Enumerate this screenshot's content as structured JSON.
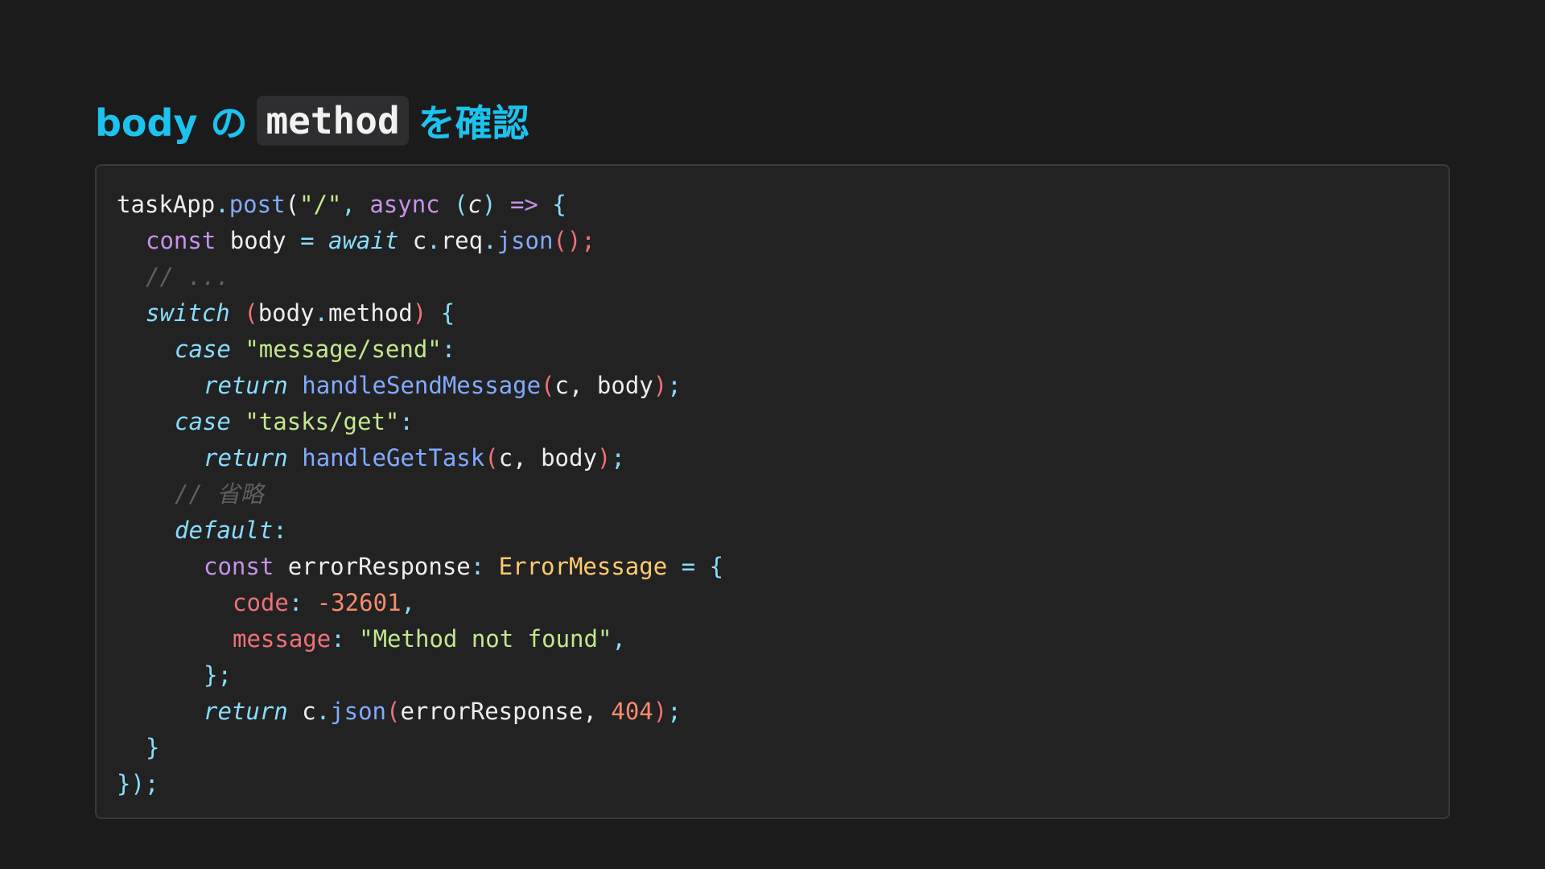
{
  "title": {
    "prefix": "body の",
    "code": "method",
    "suffix": "を確認"
  },
  "code": {
    "l1": {
      "a": "taskApp",
      "b": ".",
      "c": "post",
      "d": "(",
      "e": "\"/\"",
      "f": ", ",
      "g": "async",
      "h": " (",
      "i": "c",
      "j": ")",
      "k": " => ",
      "l": "{"
    },
    "l2": {
      "a": "const",
      "b": " body ",
      "c": "=",
      "d": " ",
      "e": "await",
      "f": " c",
      "g": ".",
      "h": "req",
      "i": ".",
      "j": "json",
      "k": "();"
    },
    "l3": {
      "a": "// ..."
    },
    "l4": {
      "a": "switch",
      "b": " (",
      "c": "body",
      "d": ".",
      "e": "method",
      "f": ")",
      "g": " {"
    },
    "l5": {
      "a": "case",
      "b": " ",
      "c": "\"message/send\"",
      "d": ":"
    },
    "l6": {
      "a": "return",
      "b": " ",
      "c": "handleSendMessage",
      "d": "(",
      "e": "c, body",
      "f": ")",
      "g": ";"
    },
    "l7": {
      "a": "case",
      "b": " ",
      "c": "\"tasks/get\"",
      "d": ":"
    },
    "l8": {
      "a": "return",
      "b": " ",
      "c": "handleGetTask",
      "d": "(",
      "e": "c, body",
      "f": ")",
      "g": ";"
    },
    "l9": {
      "a": "// 省略"
    },
    "l10": {
      "a": "default",
      "b": ":"
    },
    "l11": {
      "a": "const",
      "b": " errorResponse",
      "c": ": ",
      "d": "ErrorMessage",
      "e": " = ",
      "f": "{"
    },
    "l12": {
      "a": "code",
      "b": ": ",
      "c": "-32601",
      "d": ","
    },
    "l13": {
      "a": "message",
      "b": ": ",
      "c": "\"Method not found\"",
      "d": ","
    },
    "l14": {
      "a": "};"
    },
    "l15": {
      "a": "return",
      "b": " c",
      "c": ".",
      "d": "json",
      "e": "(",
      "f": "errorResponse, ",
      "g": "404",
      "h": ")",
      "i": ";"
    },
    "l16": {
      "a": "}"
    },
    "l17": {
      "a": "});"
    }
  },
  "colors": {
    "background": "#1b1b1c",
    "panel": "#222223",
    "title": "#1cc3ee",
    "keyword": "#c792ea",
    "function": "#82aaff",
    "string": "#c3e88d",
    "number": "#f78c6c",
    "property": "#f07178",
    "type": "#ffcb6b",
    "comment": "#5f5f62"
  }
}
